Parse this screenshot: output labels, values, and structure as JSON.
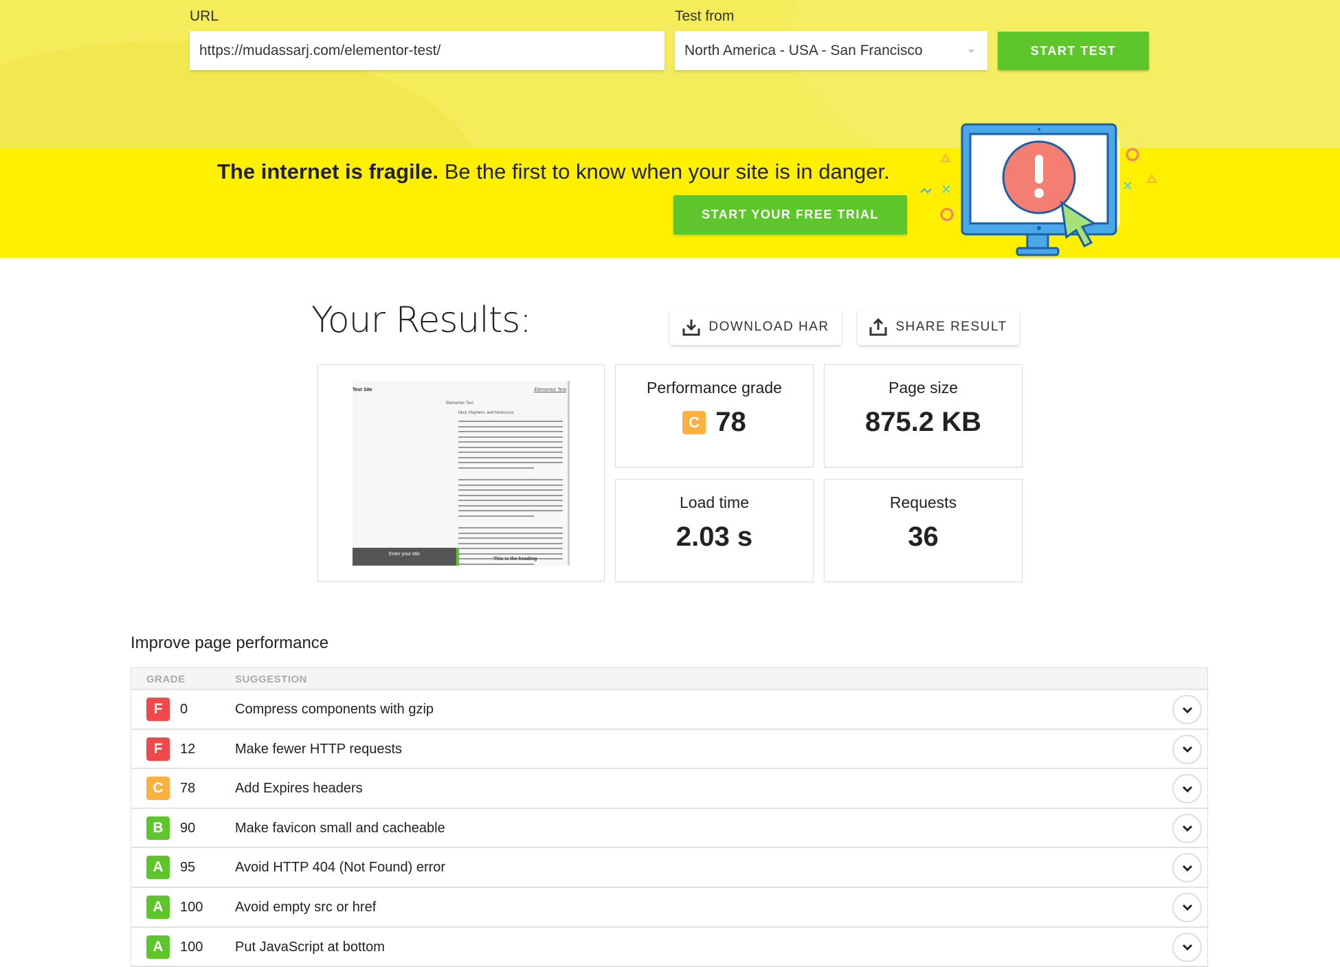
{
  "form": {
    "url_label": "URL",
    "url_value": "https://mudassarj.com/elementor-test/",
    "from_label": "Test from",
    "from_value": "North America - USA - San Francisco",
    "start_label": "START TEST"
  },
  "banner": {
    "headline_bold": "The internet is fragile.",
    "headline_rest": " Be the first to know when your site is in danger.",
    "cta": "START YOUR FREE TRIAL"
  },
  "results": {
    "title": "Your Results:",
    "download": "DOWNLOAD HAR",
    "share": "SHARE RESULT",
    "thumbnail": {
      "site": "Test Site",
      "nav": "Elementor Test",
      "page_title": "Elementor Test",
      "post_title": "Mud, Mayhem, and Motocross",
      "footer_left": "Enter your title",
      "footer_right": "This is the heading"
    },
    "perf_label": "Performance grade",
    "perf_grade": "C",
    "perf_score": "78",
    "size_label": "Page size",
    "size_value": "875.2 KB",
    "load_label": "Load time",
    "load_value": "2.03 s",
    "req_label": "Requests",
    "req_value": "36"
  },
  "improve": {
    "title": "Improve page performance",
    "col_grade": "GRADE",
    "col_suggestion": "SUGGESTION",
    "rows": [
      {
        "grade": "F",
        "score": "0",
        "suggestion": "Compress components with gzip"
      },
      {
        "grade": "F",
        "score": "12",
        "suggestion": "Make fewer HTTP requests"
      },
      {
        "grade": "C",
        "score": "78",
        "suggestion": "Add Expires headers"
      },
      {
        "grade": "B",
        "score": "90",
        "suggestion": "Make favicon small and cacheable"
      },
      {
        "grade": "A",
        "score": "95",
        "suggestion": "Avoid HTTP 404 (Not Found) error"
      },
      {
        "grade": "A",
        "score": "100",
        "suggestion": "Avoid empty src or href"
      },
      {
        "grade": "A",
        "score": "100",
        "suggestion": "Put JavaScript at bottom"
      }
    ]
  },
  "colors": {
    "F": "#f2484c",
    "C": "#fbb040",
    "B": "#5ec62c",
    "A": "#5ec62c",
    "green": "#5ec62c",
    "banner": "#fef000"
  }
}
